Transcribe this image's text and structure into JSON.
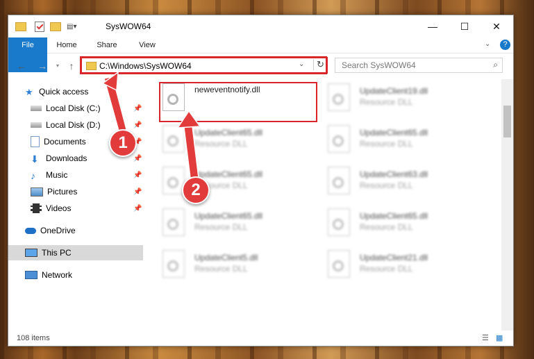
{
  "window": {
    "title": "SysWOW64"
  },
  "ribbon": {
    "tabs": [
      "File",
      "Home",
      "Share",
      "View"
    ]
  },
  "address": {
    "path": "C:\\Windows\\SysWOW64"
  },
  "search": {
    "placeholder": "Search SysWOW64"
  },
  "nav": {
    "quick_access": "Quick access",
    "items": [
      "Local Disk (C:)",
      "Local Disk (D:)",
      "Documents",
      "Downloads",
      "Music",
      "Pictures",
      "Videos"
    ],
    "onedrive": "OneDrive",
    "thispc": "This PC",
    "network": "Network"
  },
  "files": [
    {
      "name": "neweventnotify.dll",
      "type": ""
    },
    {
      "name": "UpdateClient19.dll",
      "type": "Resource DLL"
    },
    {
      "name": "UpdateClient65.dll",
      "type": "Resource DLL"
    },
    {
      "name": "UpdateClient65.dll",
      "type": "Resource DLL"
    },
    {
      "name": "UpdateClient65.dll",
      "type": "Resource DLL"
    },
    {
      "name": "UpdateClient63.dll",
      "type": "Resource DLL"
    },
    {
      "name": "UpdateClient65.dll",
      "type": "Resource DLL"
    },
    {
      "name": "UpdateClient65.dll",
      "type": "Resource DLL"
    },
    {
      "name": "UpdateClient5.dll",
      "type": "Resource DLL"
    },
    {
      "name": "UpdateClient21.dll",
      "type": "Resource DLL"
    }
  ],
  "status": {
    "count": "108 items"
  },
  "callouts": [
    "1",
    "2"
  ],
  "colors": {
    "accent": "#1979ca",
    "callout": "#e23b3b",
    "highlight": "#d9262b"
  }
}
